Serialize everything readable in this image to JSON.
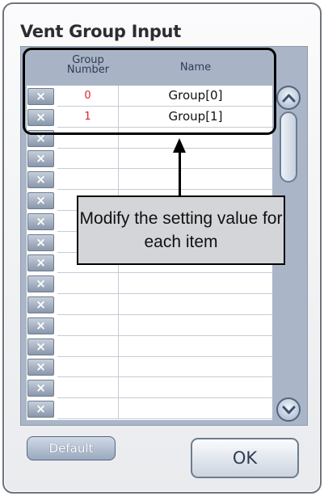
{
  "dialog": {
    "title": "Vent Group Input"
  },
  "table": {
    "columns": {
      "group_number": "Group\nNumber",
      "name": "Name"
    },
    "delete_label": "×",
    "rows": [
      {
        "number": "0",
        "name": "Group[0]"
      },
      {
        "number": "1",
        "name": "Group[1]"
      },
      {
        "number": "",
        "name": ""
      },
      {
        "number": "",
        "name": ""
      },
      {
        "number": "",
        "name": ""
      },
      {
        "number": "",
        "name": ""
      },
      {
        "number": "",
        "name": ""
      },
      {
        "number": "",
        "name": ""
      },
      {
        "number": "",
        "name": ""
      },
      {
        "number": "",
        "name": ""
      },
      {
        "number": "",
        "name": ""
      },
      {
        "number": "",
        "name": ""
      },
      {
        "number": "",
        "name": ""
      },
      {
        "number": "",
        "name": ""
      },
      {
        "number": "",
        "name": ""
      },
      {
        "number": "",
        "name": ""
      }
    ]
  },
  "callout": {
    "text": "Modify the setting value for each item"
  },
  "buttons": {
    "default_label": "Default",
    "ok_label": "OK"
  },
  "icons": {
    "scroll_up": "chevron-up-icon",
    "scroll_down": "chevron-down-icon",
    "delete": "close-icon"
  },
  "colors": {
    "panel": "#aab6c8",
    "number_text": "#e0202a",
    "highlight_border": "#000000",
    "callout_bg": "#d3d5d8"
  }
}
